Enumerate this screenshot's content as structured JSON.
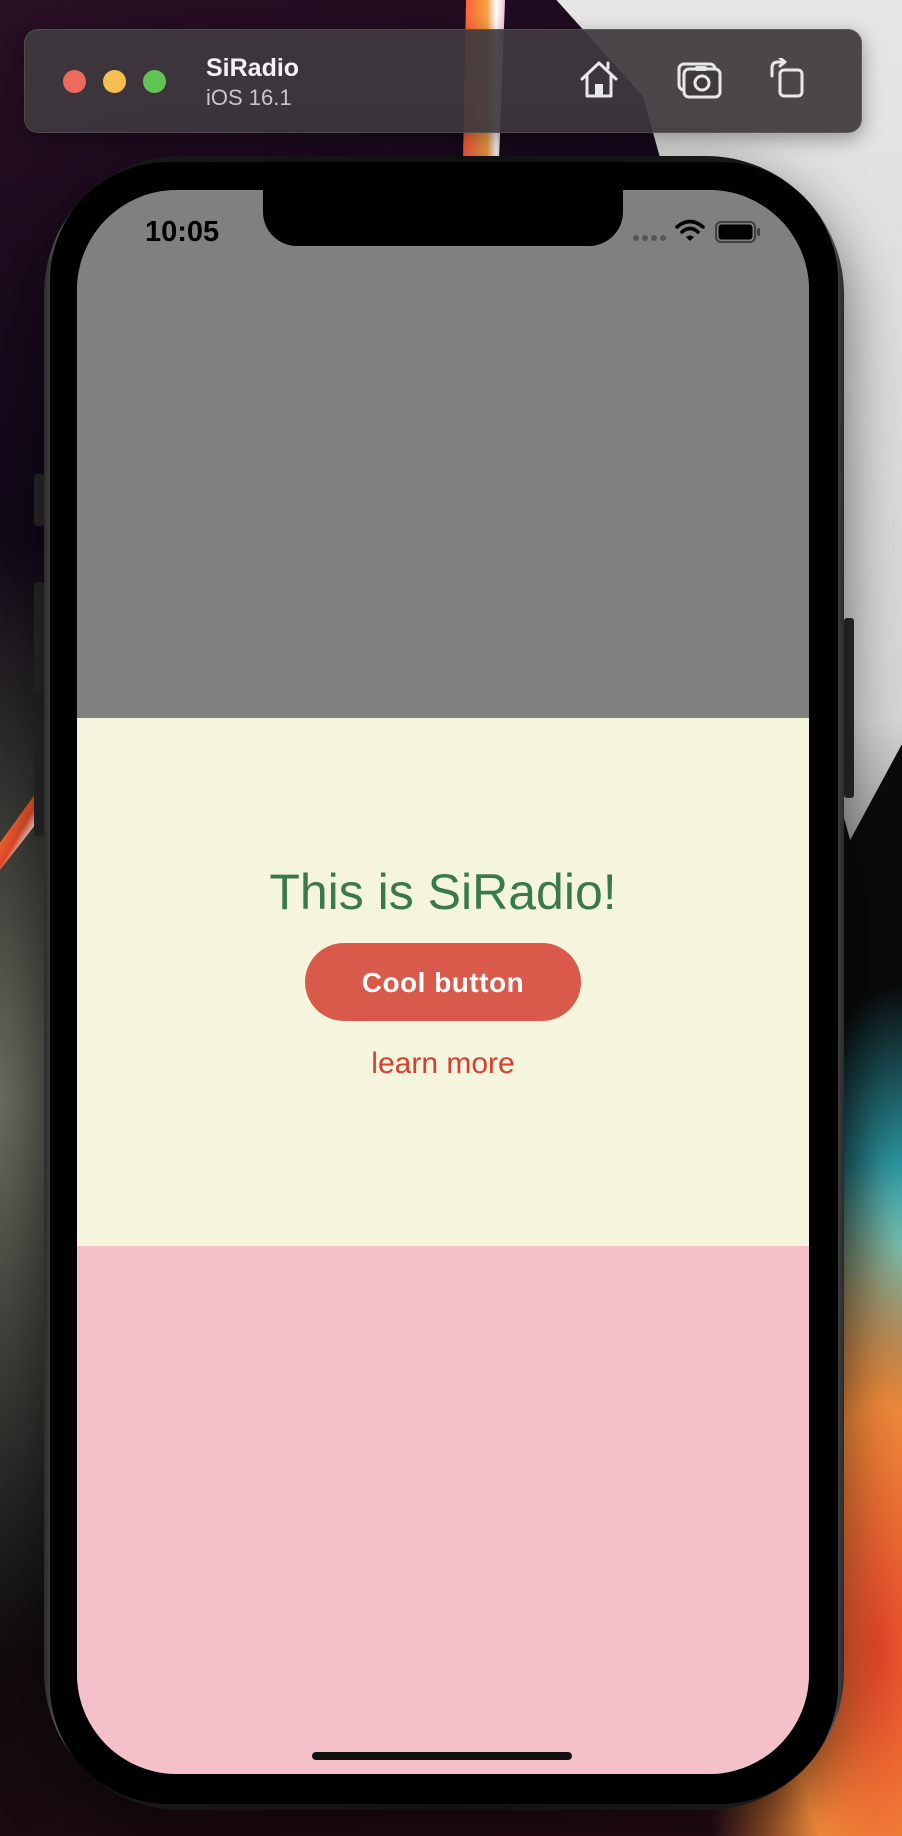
{
  "simulator": {
    "app_name": "SiRadio",
    "os_version": "iOS 16.1",
    "toolbar_icons": [
      "home-icon",
      "screenshot-icon",
      "rotate-icon"
    ]
  },
  "status_bar": {
    "time": "10:05",
    "icons": [
      "cellular-icon",
      "wifi-icon",
      "battery-icon"
    ]
  },
  "content": {
    "title": "This is SiRadio!",
    "primary_button": "Cool button",
    "link": "learn more"
  },
  "colors": {
    "top_section": "#808080",
    "middle_section": "#f5f5de",
    "bottom_section": "#f4c1cb",
    "title_text": "#3a7a48",
    "button_bg": "#d9594a",
    "link_text": "#d6402e"
  }
}
